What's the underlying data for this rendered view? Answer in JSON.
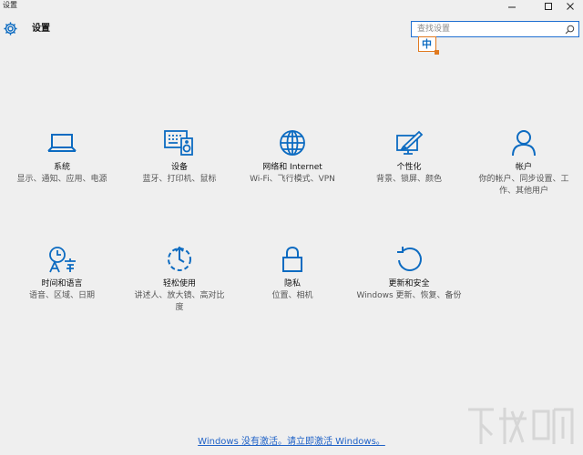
{
  "window": {
    "title": "设置"
  },
  "header": {
    "title": "设置"
  },
  "search": {
    "placeholder": "查找设置",
    "ime_indicator": "中"
  },
  "categories": [
    {
      "label": "系统",
      "description": "显示、通知、应用、电源",
      "icon": "laptop-icon"
    },
    {
      "label": "设备",
      "description": "蓝牙、打印机、鼠标",
      "icon": "devices-icon"
    },
    {
      "label": "网络和 Internet",
      "description": "Wi-Fi、飞行模式、VPN",
      "icon": "globe-icon"
    },
    {
      "label": "个性化",
      "description": "背景、锁屏、颜色",
      "icon": "paint-brush-icon"
    },
    {
      "label": "帐户",
      "description": "你的帐户、同步设置、工作、其他用户",
      "icon": "person-icon"
    },
    {
      "label": "时间和语言",
      "description": "语音、区域、日期",
      "icon": "time-language-icon"
    },
    {
      "label": "轻松使用",
      "description": "讲述人、放大镜、高对比度",
      "icon": "ease-of-access-icon"
    },
    {
      "label": "隐私",
      "description": "位置、相机",
      "icon": "lock-icon"
    },
    {
      "label": "更新和安全",
      "description": "Windows 更新、恢复、备份",
      "icon": "refresh-icon"
    }
  ],
  "footer": {
    "activation_link": "Windows 没有激活。请立即激活 Windows。"
  },
  "colors": {
    "accent": "#0c6bc1",
    "background": "#efefef",
    "link": "#1f62c7"
  }
}
